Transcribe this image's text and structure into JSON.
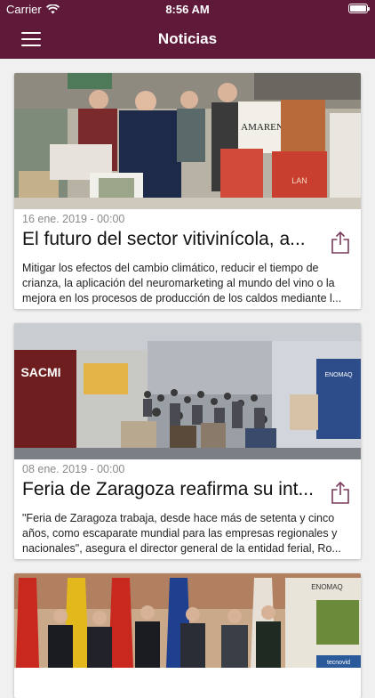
{
  "status_bar": {
    "carrier": "Carrier",
    "time": "8:56 AM"
  },
  "nav": {
    "title": "Noticias"
  },
  "colors": {
    "brand": "#5e1a38",
    "icon_accent": "#7a3a5a"
  },
  "articles": [
    {
      "date": "16 ene. 2019 - 00:00",
      "title": "El futuro del sector vitivinícola, a...",
      "summary": "Mitigar los efectos del cambio climático, reducir el tiempo de crianza, la aplicación del neuromarketing al mundo del vino o la mejora en los procesos de producción de los caldos mediante l...",
      "image_texts": {
        "brand_box": "AMAREN",
        "small_box": "LAN"
      }
    },
    {
      "date": "08 ene. 2019 - 00:00",
      "title": "Feria de Zaragoza reafirma su int...",
      "summary": "\"Feria de Zaragoza trabaja, desde hace más de setenta y cinco años, como escaparate mundial para las empresas regionales y nacionales\", asegura el director general de la entidad ferial, Ro...",
      "image_texts": {
        "stand": "SACMI",
        "banner": "ENOMAQ"
      }
    },
    {
      "image_texts": {
        "poster": "ENOMAQ",
        "poster_sub": "tecnovid"
      }
    }
  ]
}
